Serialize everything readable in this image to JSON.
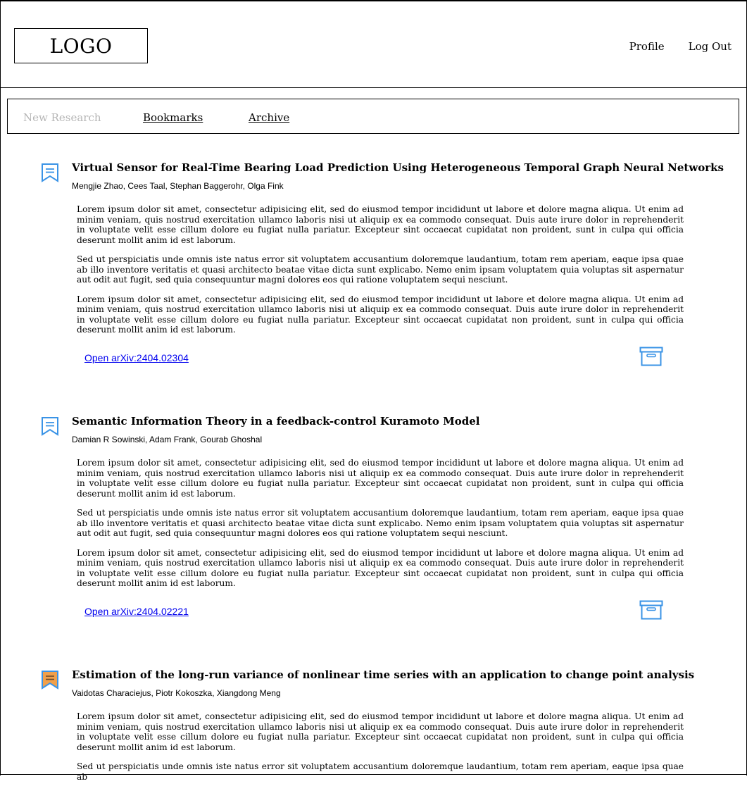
{
  "header": {
    "logo": "LOGO",
    "nav": {
      "profile": "Profile",
      "logout": "Log Out"
    }
  },
  "tabs": {
    "new_research": "New Research",
    "bookmarks": "Bookmarks",
    "archive": "Archive"
  },
  "colors": {
    "accent_blue": "#3a93e6",
    "bookmark_active": "#f0a04b",
    "link": "#0000ee"
  },
  "papers": [
    {
      "title": "Virtual Sensor for Real-Time Bearing Load Prediction Using Heterogeneous Temporal Graph Neural Networks",
      "authors": "Mengjie Zhao, Cees Taal, Stephan Baggerohr, Olga Fink",
      "paragraphs": [
        "Lorem ipsum dolor sit amet, consectetur adipisicing elit, sed do eiusmod tempor incididunt ut labore et dolore magna aliqua. Ut enim ad minim veniam, quis nostrud exercitation ullamco laboris nisi ut aliquip ex ea commodo consequat. Duis aute irure dolor in reprehenderit in voluptate velit esse cillum dolore eu fugiat nulla pariatur. Excepteur sint occaecat cupidatat non proident, sunt in culpa qui officia deserunt mollit anim id est laborum.",
        "Sed ut perspiciatis unde omnis iste natus error sit voluptatem accusantium doloremque laudantium, totam rem aperiam, eaque ipsa quae ab illo inventore veritatis et quasi architecto beatae vitae dicta sunt explicabo. Nemo enim ipsam voluptatem quia voluptas sit aspernatur aut odit aut fugit, sed quia consequuntur magni dolores eos qui ratione voluptatem sequi nesciunt.",
        "Lorem ipsum dolor sit amet, consectetur adipisicing elit, sed do eiusmod tempor incididunt ut labore et dolore magna aliqua. Ut enim ad minim veniam, quis nostrud exercitation ullamco laboris nisi ut aliquip ex ea commodo consequat. Duis aute irure dolor in reprehenderit in voluptate velit esse cillum dolore eu fugiat nulla pariatur. Excepteur sint occaecat cupidatat non proident, sunt in culpa qui officia deserunt mollit anim id est laborum."
      ],
      "link": "Open arXiv:2404.02304",
      "bookmarked": false
    },
    {
      "title": "Semantic Information Theory in a feedback-control Kuramoto Model",
      "authors": "Damian R Sowinski, Adam Frank, Gourab Ghoshal",
      "paragraphs": [
        "Lorem ipsum dolor sit amet, consectetur adipisicing elit, sed do eiusmod tempor incididunt ut labore et dolore magna aliqua. Ut enim ad minim veniam, quis nostrud exercitation ullamco laboris nisi ut aliquip ex ea commodo consequat. Duis aute irure dolor in reprehenderit in voluptate velit esse cillum dolore eu fugiat nulla pariatur. Excepteur sint occaecat cupidatat non proident, sunt in culpa qui officia deserunt mollit anim id est laborum.",
        "Sed ut perspiciatis unde omnis iste natus error sit voluptatem accusantium doloremque laudantium, totam rem aperiam, eaque ipsa quae ab illo inventore veritatis et quasi architecto beatae vitae dicta sunt explicabo. Nemo enim ipsam voluptatem quia voluptas sit aspernatur aut odit aut fugit, sed quia consequuntur magni dolores eos qui ratione voluptatem sequi nesciunt.",
        "Lorem ipsum dolor sit amet, consectetur adipisicing elit, sed do eiusmod tempor incididunt ut labore et dolore magna aliqua. Ut enim ad minim veniam, quis nostrud exercitation ullamco laboris nisi ut aliquip ex ea commodo consequat. Duis aute irure dolor in reprehenderit in voluptate velit esse cillum dolore eu fugiat nulla pariatur. Excepteur sint occaecat cupidatat non proident, sunt in culpa qui officia deserunt mollit anim id est laborum."
      ],
      "link": "Open arXiv:2404.02221",
      "bookmarked": false
    },
    {
      "title": "Estimation of the long-run variance of nonlinear time series with an application to change point analysis",
      "authors": "Vaidotas Characiejus, Piotr Kokoszka, Xiangdong Meng",
      "paragraphs": [
        "Lorem ipsum dolor sit amet, consectetur adipisicing elit, sed do eiusmod tempor incididunt ut labore et dolore magna aliqua. Ut enim ad minim veniam, quis nostrud exercitation ullamco laboris nisi ut aliquip ex ea commodo consequat. Duis aute irure dolor in reprehenderit in voluptate velit esse cillum dolore eu fugiat nulla pariatur. Excepteur sint occaecat cupidatat non proident, sunt in culpa qui officia deserunt mollit anim id est laborum.",
        "Sed ut perspiciatis unde omnis iste natus error sit voluptatem accusantium doloremque laudantium, totam rem aperiam, eaque ipsa quae ab"
      ],
      "bookmarked": true
    }
  ]
}
